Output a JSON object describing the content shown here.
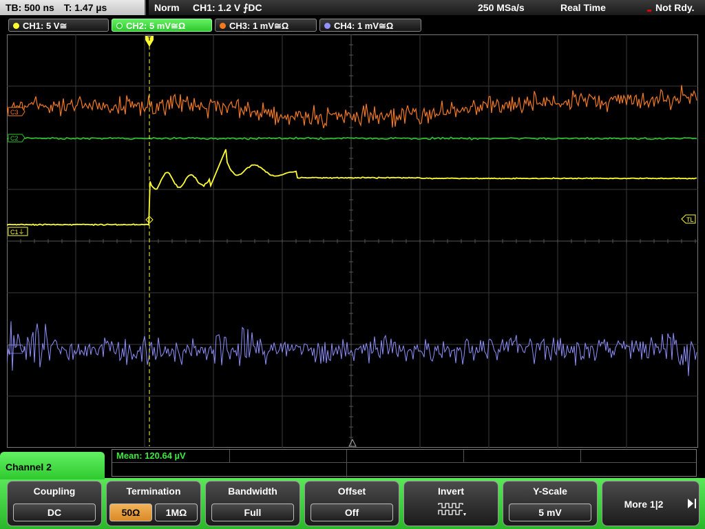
{
  "status": {
    "timebase": "TB: 500 ns",
    "trigger_time": "T: 1.47 µs",
    "mode": "Norm",
    "trigger": "CH1: 1.2 V ⨍DC",
    "sample_rate": "250 MSa/s",
    "acq_mode": "Real Time",
    "state": "Not Rdy."
  },
  "channels": [
    {
      "label": "CH1: 5 V≅",
      "color": "#ffff33"
    },
    {
      "label": "CH2: 5 mV≅Ω",
      "color": "#2ec82e"
    },
    {
      "label": "CH3: 1 mV≅Ω",
      "color": "#f47a22"
    },
    {
      "label": "CH4: 1 mV≅Ω",
      "color": "#9090ff"
    }
  ],
  "markers": {
    "c1": "C1⏚",
    "c3": "C3",
    "c2": "C2",
    "tl": "TL",
    "trigger_pos": "T"
  },
  "measurement": {
    "text": "Mean: 120.64 µV"
  },
  "menu": {
    "title": "Channel 2",
    "softkeys": {
      "coupling": {
        "label": "Coupling",
        "value": "DC"
      },
      "termination": {
        "label": "Termination",
        "opt1": "50Ω",
        "opt2": "1MΩ",
        "selected": "50Ω"
      },
      "bandwidth": {
        "label": "Bandwidth",
        "value": "Full"
      },
      "offset": {
        "label": "Offset",
        "value": "Off"
      },
      "invert": {
        "label": "Invert",
        "icon": "invert-square-wave-icon"
      },
      "yscale": {
        "label": "Y-Scale",
        "value": "5 mV"
      },
      "more": {
        "label": "More 1|2",
        "icon": "next-page-icon"
      }
    }
  },
  "colors": {
    "ch1": "#ffff33",
    "ch2": "#2ec82e",
    "ch3": "#f47a22",
    "ch4": "#9090ff",
    "grid": "#555555",
    "menu_green": "#3ad83a",
    "selected_option": "#e89d3a"
  }
}
